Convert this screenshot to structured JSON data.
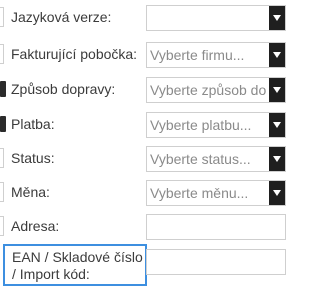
{
  "form": {
    "rows": [
      {
        "label": "Jazyková verze:",
        "value": ""
      },
      {
        "label": "Fakturující pobočka:",
        "value": "Vyberte firmu..."
      },
      {
        "label": "Způsob dopravy:",
        "value": "Vyberte způsob dop"
      },
      {
        "label": "Platba:",
        "value": "Vyberte platbu..."
      },
      {
        "label": "Status:",
        "value": "Vyberte status..."
      },
      {
        "label": "Měna:",
        "value": "Vyberte měnu..."
      },
      {
        "label": "Adresa:",
        "value": ""
      }
    ],
    "ean": {
      "label": "EAN / Skladové číslo / Import kód:",
      "value": ""
    }
  }
}
